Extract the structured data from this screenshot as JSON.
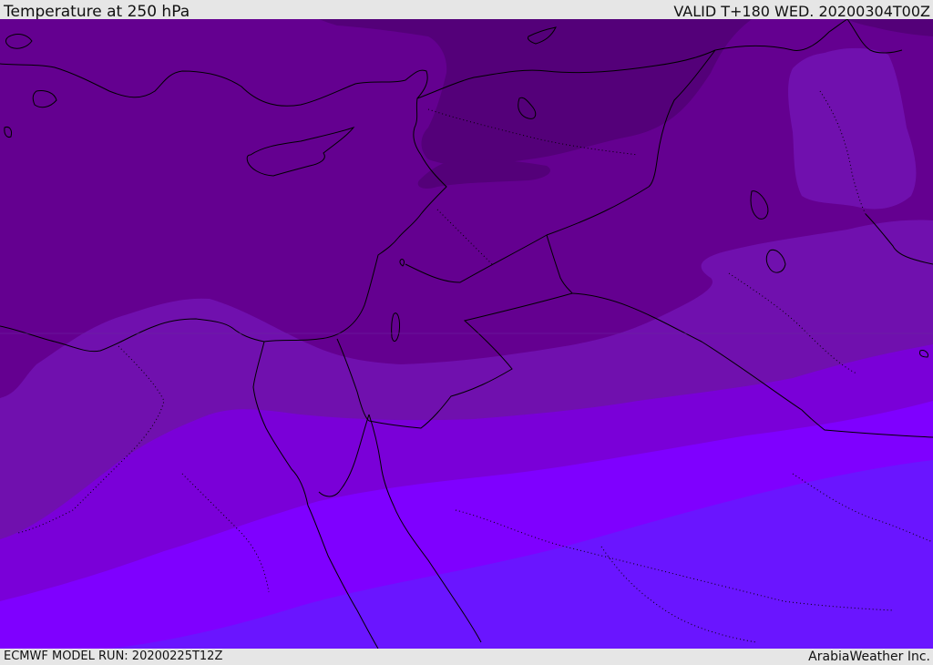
{
  "header": {
    "title": "Temperature at 250 hPa",
    "valid": "VALID T+180 WED. 20200304T00Z"
  },
  "footer": {
    "model_run": "ECMWF MODEL RUN: 20200225T12Z",
    "credit": "ArabiaWeather Inc."
  },
  "map": {
    "field": "temperature-250hPa",
    "band_colors": [
      "#540079",
      "#640090",
      "#7010ae",
      "#7a00d8",
      "#7f00ff",
      "#6a15ff"
    ],
    "border_color": "#000000"
  }
}
